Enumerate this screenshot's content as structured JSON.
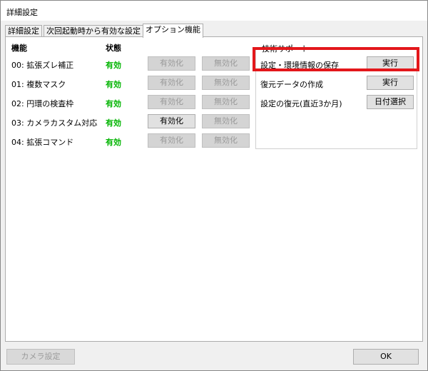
{
  "window": {
    "title": "詳細設定"
  },
  "tabs": [
    {
      "label": "詳細設定"
    },
    {
      "label": "次回起動時から有効な設定"
    },
    {
      "label": "オプション機能"
    }
  ],
  "table": {
    "col_feature": "機能",
    "col_status": "状態",
    "rows": [
      {
        "label": "00: 拡張ズレ補正",
        "status": "有効",
        "enable": "有効化",
        "disable": "無効化"
      },
      {
        "label": "01: 複数マスク",
        "status": "有効",
        "enable": "有効化",
        "disable": "無効化"
      },
      {
        "label": "02: 円環の検査枠",
        "status": "有効",
        "enable": "有効化",
        "disable": "無効化"
      },
      {
        "label": "03: カメラカスタム対応",
        "status": "有効",
        "enable": "有効化",
        "disable": "無効化"
      },
      {
        "label": "04: 拡張コマンド",
        "status": "有効",
        "enable": "有効化",
        "disable": "無効化"
      }
    ]
  },
  "support": {
    "title": "技術サポート",
    "items": [
      {
        "label": "設定・環境情報の保存",
        "button": "実行"
      },
      {
        "label": "復元データの作成",
        "button": "実行"
      },
      {
        "label": "設定の復元(直近3か月)",
        "button": "日付選択"
      }
    ]
  },
  "footer": {
    "camera_settings": "カメラ設定",
    "ok": "OK"
  },
  "colors": {
    "status_active": "#00b400",
    "highlight": "#e3171b"
  }
}
